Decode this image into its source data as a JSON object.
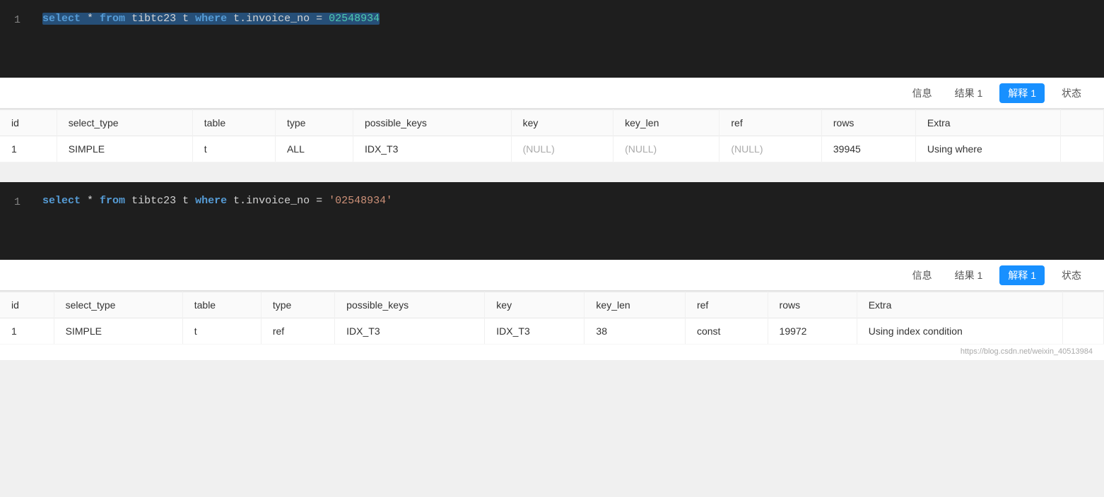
{
  "query1": {
    "line_number": "1",
    "code": "select * from  tibtc23 t where t.invoice_no  =  02548934",
    "selected": true
  },
  "query2": {
    "line_number": "1",
    "code": "select * from  tibtc23 t where t.invoice_no  =  '02548934'"
  },
  "toolbar1": {
    "info_label": "信息",
    "result_label": "结果 1",
    "explain_label": "解释 1",
    "status_label": "状态"
  },
  "toolbar2": {
    "info_label": "信息",
    "result_label": "结果 1",
    "explain_label": "解释 1",
    "status_label": "状态"
  },
  "table1": {
    "columns": [
      "id",
      "select_type",
      "table",
      "type",
      "possible_keys",
      "key",
      "key_len",
      "ref",
      "rows",
      "Extra"
    ],
    "rows": [
      {
        "id": "1",
        "select_type": "SIMPLE",
        "table": "t",
        "type": "ALL",
        "possible_keys": "IDX_T3",
        "key": "(NULL)",
        "key_len": "(NULL)",
        "ref": "(NULL)",
        "rows": "39945",
        "extra": "Using where"
      }
    ]
  },
  "table2": {
    "columns": [
      "id",
      "select_type",
      "table",
      "type",
      "possible_keys",
      "key",
      "key_len",
      "ref",
      "rows",
      "Extra"
    ],
    "rows": [
      {
        "id": "1",
        "select_type": "SIMPLE",
        "table": "t",
        "type": "ref",
        "possible_keys": "IDX_T3",
        "key": "IDX_T3",
        "key_len": "38",
        "ref": "const",
        "rows": "19972",
        "extra": "Using index condition"
      }
    ]
  },
  "watermark": "https://blog.csdn.net/weixin_40513984"
}
